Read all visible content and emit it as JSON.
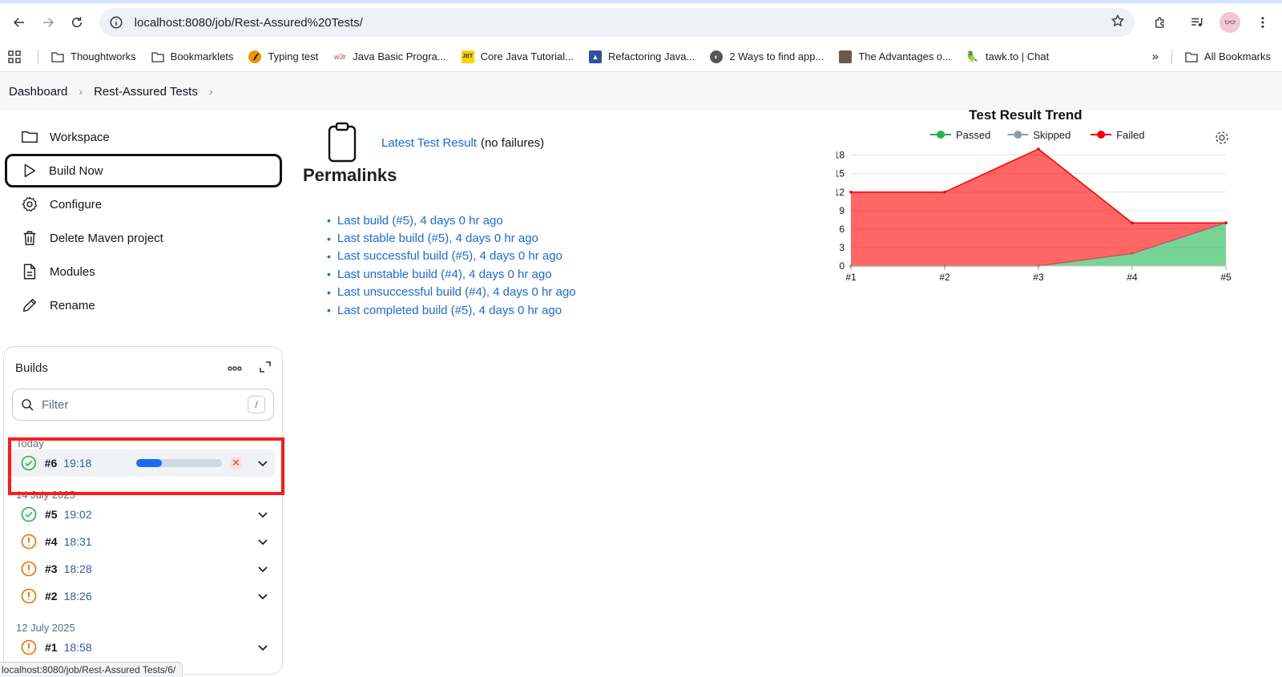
{
  "browser": {
    "url": "localhost:8080/job/Rest-Assured%20Tests/",
    "bookmarks": [
      {
        "label": "Thoughtworks",
        "icon": "folder-icon"
      },
      {
        "label": "Bookmarklets",
        "icon": "folder-icon"
      },
      {
        "label": "Typing test",
        "icon": "typing-icon"
      },
      {
        "label": "Java Basic Progra...",
        "icon": "w3r-icon"
      },
      {
        "label": "Core Java Tutorial...",
        "icon": "jbt-icon"
      },
      {
        "label": "Refactoring Java...",
        "icon": "mountain-icon"
      },
      {
        "label": "2 Ways to find app...",
        "icon": "globe-icon"
      },
      {
        "label": "The Advantages o...",
        "icon": "photo-icon"
      },
      {
        "label": "tawk.to | Chat",
        "icon": "parrot-icon"
      }
    ],
    "all_bookmarks": "All Bookmarks",
    "status_url": "localhost:8080/job/Rest-Assured Tests/6/"
  },
  "breadcrumbs": [
    "Dashboard",
    "Rest-Assured Tests"
  ],
  "sidebar": {
    "tasks": [
      {
        "label": "Workspace"
      },
      {
        "label": "Build Now"
      },
      {
        "label": "Configure"
      },
      {
        "label": "Delete Maven project"
      },
      {
        "label": "Modules"
      },
      {
        "label": "Rename"
      }
    ]
  },
  "builds": {
    "title": "Builds",
    "filter_placeholder": "Filter",
    "filter_shortcut": "/",
    "groups": [
      {
        "label": "Today",
        "rows": [
          {
            "num": "#6",
            "time": "19:18",
            "status": "success",
            "running": true,
            "progress": 0.3
          }
        ]
      },
      {
        "label": "14 July 2025",
        "rows": [
          {
            "num": "#5",
            "time": "19:02",
            "status": "success"
          },
          {
            "num": "#4",
            "time": "18:31",
            "status": "unstable"
          },
          {
            "num": "#3",
            "time": "18:28",
            "status": "unstable"
          },
          {
            "num": "#2",
            "time": "18:26",
            "status": "unstable"
          }
        ]
      },
      {
        "label": "12 July 2025",
        "rows": [
          {
            "num": "#1",
            "time": "18:58",
            "status": "unstable"
          }
        ]
      }
    ]
  },
  "main": {
    "latest_test_result": "Latest Test Result",
    "latest_note": "(no failures)",
    "permalinks_title": "Permalinks",
    "permalinks": [
      "Last build (#5), 4 days 0 hr ago",
      "Last stable build (#5), 4 days 0 hr ago",
      "Last successful build (#5), 4 days 0 hr ago",
      "Last unstable build (#4), 4 days 0 hr ago",
      "Last unsuccessful build (#4), 4 days 0 hr ago",
      "Last completed build (#5), 4 days 0 hr ago"
    ]
  },
  "chart_data": {
    "type": "area",
    "title": "Test Result Trend",
    "categories": [
      "#1",
      "#2",
      "#3",
      "#4",
      "#5"
    ],
    "series": [
      {
        "name": "Passed",
        "color": "#1eb84a",
        "values": [
          0,
          0,
          0,
          2,
          7
        ]
      },
      {
        "name": "Skipped",
        "color": "#8f9bab",
        "values": [
          0,
          0,
          0,
          0,
          0
        ]
      },
      {
        "name": "Failed",
        "color": "#ff0000",
        "values": [
          12,
          12,
          19,
          5,
          0
        ]
      }
    ],
    "stacked": true,
    "yticks": [
      0,
      3,
      6,
      9,
      12,
      15,
      18
    ],
    "ylim": [
      0,
      19
    ],
    "legend": "top",
    "grid": true
  }
}
